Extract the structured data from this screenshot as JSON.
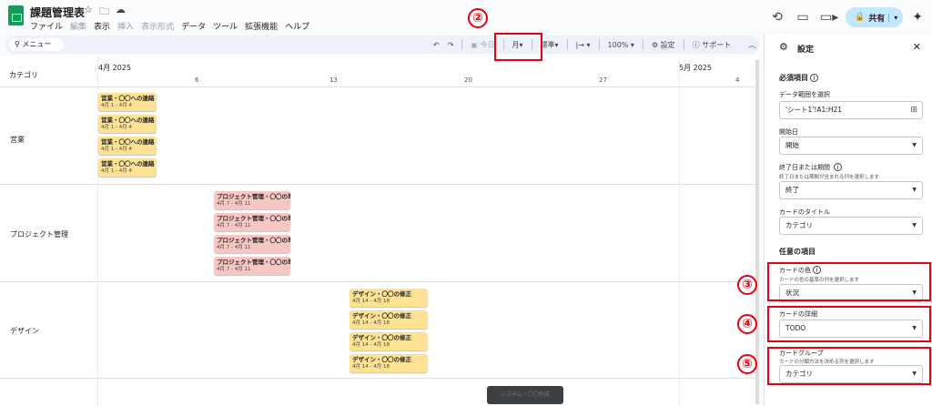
{
  "header": {
    "title": "課題管理表",
    "menu": [
      "ファイル",
      "編集",
      "表示",
      "挿入",
      "表示形式",
      "データ",
      "ツール",
      "拡張機能",
      "ヘルプ"
    ],
    "dim_menu": [
      false,
      true,
      false,
      true,
      true,
      false,
      false,
      false,
      false
    ],
    "share_label": "共有"
  },
  "toolbar": {
    "menu_search": "メニュー",
    "today": "今日",
    "view": "月",
    "standard": "標準",
    "zoom": "100%",
    "settings": "設定",
    "support": "サポート"
  },
  "timeline": {
    "category_header": "カテゴリ",
    "months": [
      "4月 2025",
      "5月 2025"
    ],
    "days": [
      "6",
      "13",
      "20",
      "27",
      "4"
    ],
    "categories": [
      "営業",
      "プロジェクト管理",
      "デザイン"
    ],
    "cards": {
      "sales": {
        "title": "営業・〇〇への連絡",
        "dates": "4月 1 - 4月 4"
      },
      "pm": {
        "title": "プロジェクト管理・〇〇の準備",
        "dates": "4月 7 - 4月 11"
      },
      "design": {
        "title": "デザイン・〇〇の修正",
        "dates": "4月 14 - 4月 18"
      }
    },
    "toast": "システム・〇〇作成"
  },
  "panel": {
    "title": "設定",
    "required": "必須項目",
    "range_label": "データ範囲を選択",
    "range_value": "'シート1'!A1:H21",
    "start_label": "開始日",
    "start_value": "開始",
    "end_label": "終了日または期間",
    "end_help": "終了日または期間が含まれる列を選択します",
    "end_value": "終了",
    "card_title_label": "カードのタイトル",
    "card_title_value": "カテゴリ",
    "optional": "任意の項目",
    "card_color_label": "カードの色",
    "card_color_help": "カードの色の基準の列を選択します",
    "card_color_value": "状況",
    "card_detail_label": "カードの詳細",
    "card_detail_value": "TODO",
    "card_group_label": "カードグループ",
    "card_group_help": "カードの分類方法を決める列を選択します",
    "card_group_value": "カテゴリ"
  },
  "annotations": [
    "②",
    "③",
    "④",
    "⑤"
  ],
  "colors": {
    "annotation": "#e60012",
    "card_yellow": "#fde293",
    "card_pink": "#f8c7c3",
    "share": "#c2e7ff",
    "logo": "#0f9d58"
  }
}
